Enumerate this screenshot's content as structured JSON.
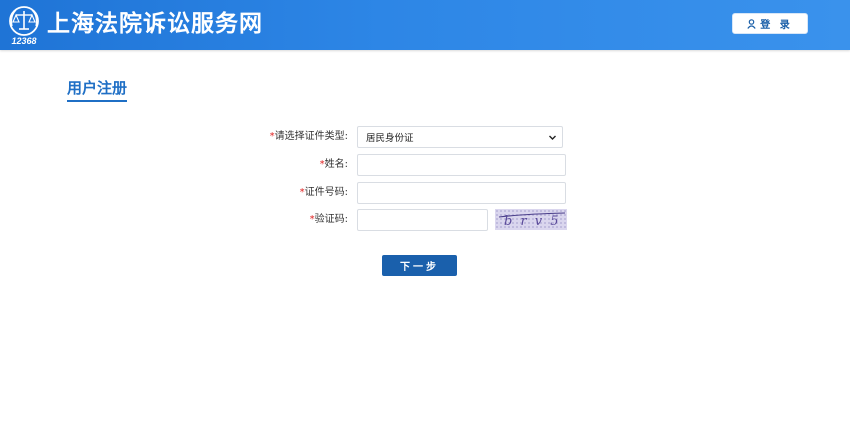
{
  "header": {
    "logo_text": "12368",
    "title": "上海法院诉讼服务网",
    "login_label": "登 录",
    "login_icon": "user-icon"
  },
  "page": {
    "title": "用户注册"
  },
  "form": {
    "required_mark": "*",
    "id_type": {
      "label": "请选择证件类型:",
      "selected": "居民身份证"
    },
    "name": {
      "label": "姓名:",
      "value": ""
    },
    "id_number": {
      "label": "证件号码:",
      "value": ""
    },
    "captcha": {
      "label": "验证码:",
      "value": "",
      "image_text": "b r v 5"
    },
    "next_label": "下一步"
  },
  "colors": {
    "header_blue": "#2d86e6",
    "button_blue": "#1a60ac",
    "title_blue": "#1f6fc5",
    "required_red": "#e02020"
  }
}
